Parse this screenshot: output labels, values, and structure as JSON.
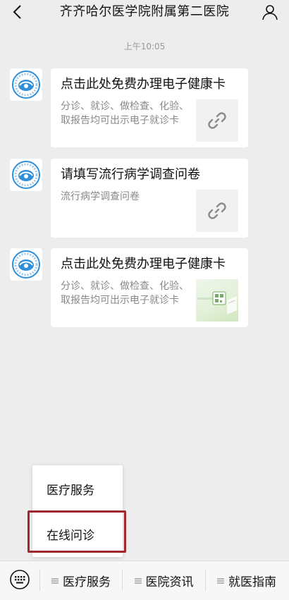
{
  "header": {
    "title": "齐齐哈尔医学院附属第二医院"
  },
  "time_label": "上午10:05",
  "messages": [
    {
      "title": "点击此处免费办理电子健康卡",
      "desc": "分诊、就诊、做检查、化验、取报告均可出示电子就诊卡",
      "thumb_icon": "link-icon"
    },
    {
      "title": "请填写流行病学调查问卷",
      "desc": "流行病学调查问卷",
      "thumb_icon": "link-icon"
    },
    {
      "title": "点击此处免费办理电子健康卡",
      "desc": "分诊、就诊、做检查、化验、取报告均可出示电子就诊卡",
      "thumb_icon": "health-card-image"
    }
  ],
  "popup_menu": {
    "items": [
      "医疗服务",
      "在线问诊"
    ]
  },
  "bottom_menu": {
    "tabs": [
      "医疗服务",
      "医院资讯",
      "就医指南"
    ]
  },
  "colors": {
    "highlight_border": "#a1272c",
    "logo_blue": "#2f8fd8"
  }
}
